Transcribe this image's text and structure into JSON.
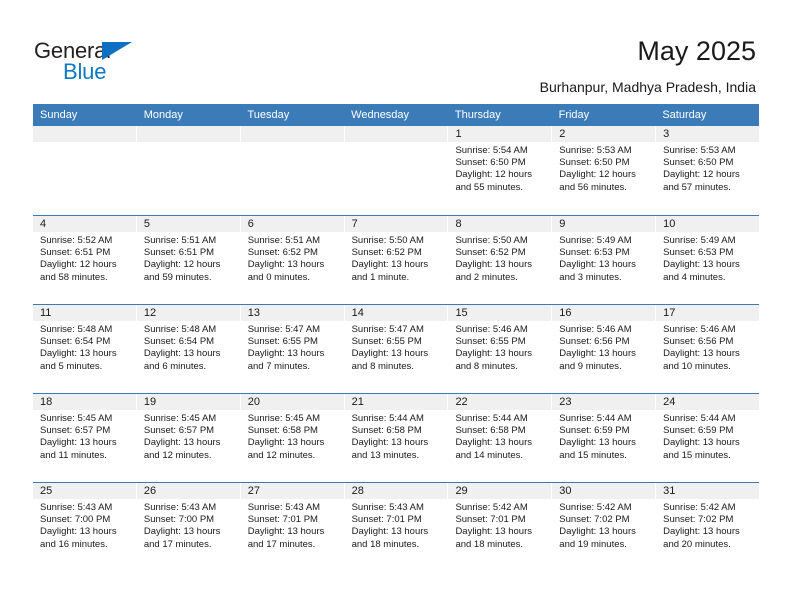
{
  "brand": {
    "name_part1": "General",
    "name_part2": "Blue"
  },
  "header": {
    "title": "May 2025",
    "subtitle": "Burhanpur, Madhya Pradesh, India"
  },
  "colors": {
    "header_blue": "#3b7cb8",
    "brand_blue": "#1079c4",
    "daynum_band": "#f0f0f0"
  },
  "calendar": {
    "day_names": [
      "Sunday",
      "Monday",
      "Tuesday",
      "Wednesday",
      "Thursday",
      "Friday",
      "Saturday"
    ],
    "weeks": [
      [
        {
          "day": "",
          "empty": true
        },
        {
          "day": "",
          "empty": true
        },
        {
          "day": "",
          "empty": true
        },
        {
          "day": "",
          "empty": true
        },
        {
          "day": "1",
          "sunrise": "Sunrise: 5:54 AM",
          "sunset": "Sunset: 6:50 PM",
          "daylight": "Daylight: 12 hours and 55 minutes."
        },
        {
          "day": "2",
          "sunrise": "Sunrise: 5:53 AM",
          "sunset": "Sunset: 6:50 PM",
          "daylight": "Daylight: 12 hours and 56 minutes."
        },
        {
          "day": "3",
          "sunrise": "Sunrise: 5:53 AM",
          "sunset": "Sunset: 6:50 PM",
          "daylight": "Daylight: 12 hours and 57 minutes."
        }
      ],
      [
        {
          "day": "4",
          "sunrise": "Sunrise: 5:52 AM",
          "sunset": "Sunset: 6:51 PM",
          "daylight": "Daylight: 12 hours and 58 minutes."
        },
        {
          "day": "5",
          "sunrise": "Sunrise: 5:51 AM",
          "sunset": "Sunset: 6:51 PM",
          "daylight": "Daylight: 12 hours and 59 minutes."
        },
        {
          "day": "6",
          "sunrise": "Sunrise: 5:51 AM",
          "sunset": "Sunset: 6:52 PM",
          "daylight": "Daylight: 13 hours and 0 minutes."
        },
        {
          "day": "7",
          "sunrise": "Sunrise: 5:50 AM",
          "sunset": "Sunset: 6:52 PM",
          "daylight": "Daylight: 13 hours and 1 minute."
        },
        {
          "day": "8",
          "sunrise": "Sunrise: 5:50 AM",
          "sunset": "Sunset: 6:52 PM",
          "daylight": "Daylight: 13 hours and 2 minutes."
        },
        {
          "day": "9",
          "sunrise": "Sunrise: 5:49 AM",
          "sunset": "Sunset: 6:53 PM",
          "daylight": "Daylight: 13 hours and 3 minutes."
        },
        {
          "day": "10",
          "sunrise": "Sunrise: 5:49 AM",
          "sunset": "Sunset: 6:53 PM",
          "daylight": "Daylight: 13 hours and 4 minutes."
        }
      ],
      [
        {
          "day": "11",
          "sunrise": "Sunrise: 5:48 AM",
          "sunset": "Sunset: 6:54 PM",
          "daylight": "Daylight: 13 hours and 5 minutes."
        },
        {
          "day": "12",
          "sunrise": "Sunrise: 5:48 AM",
          "sunset": "Sunset: 6:54 PM",
          "daylight": "Daylight: 13 hours and 6 minutes."
        },
        {
          "day": "13",
          "sunrise": "Sunrise: 5:47 AM",
          "sunset": "Sunset: 6:55 PM",
          "daylight": "Daylight: 13 hours and 7 minutes."
        },
        {
          "day": "14",
          "sunrise": "Sunrise: 5:47 AM",
          "sunset": "Sunset: 6:55 PM",
          "daylight": "Daylight: 13 hours and 8 minutes."
        },
        {
          "day": "15",
          "sunrise": "Sunrise: 5:46 AM",
          "sunset": "Sunset: 6:55 PM",
          "daylight": "Daylight: 13 hours and 8 minutes."
        },
        {
          "day": "16",
          "sunrise": "Sunrise: 5:46 AM",
          "sunset": "Sunset: 6:56 PM",
          "daylight": "Daylight: 13 hours and 9 minutes."
        },
        {
          "day": "17",
          "sunrise": "Sunrise: 5:46 AM",
          "sunset": "Sunset: 6:56 PM",
          "daylight": "Daylight: 13 hours and 10 minutes."
        }
      ],
      [
        {
          "day": "18",
          "sunrise": "Sunrise: 5:45 AM",
          "sunset": "Sunset: 6:57 PM",
          "daylight": "Daylight: 13 hours and 11 minutes."
        },
        {
          "day": "19",
          "sunrise": "Sunrise: 5:45 AM",
          "sunset": "Sunset: 6:57 PM",
          "daylight": "Daylight: 13 hours and 12 minutes."
        },
        {
          "day": "20",
          "sunrise": "Sunrise: 5:45 AM",
          "sunset": "Sunset: 6:58 PM",
          "daylight": "Daylight: 13 hours and 12 minutes."
        },
        {
          "day": "21",
          "sunrise": "Sunrise: 5:44 AM",
          "sunset": "Sunset: 6:58 PM",
          "daylight": "Daylight: 13 hours and 13 minutes."
        },
        {
          "day": "22",
          "sunrise": "Sunrise: 5:44 AM",
          "sunset": "Sunset: 6:58 PM",
          "daylight": "Daylight: 13 hours and 14 minutes."
        },
        {
          "day": "23",
          "sunrise": "Sunrise: 5:44 AM",
          "sunset": "Sunset: 6:59 PM",
          "daylight": "Daylight: 13 hours and 15 minutes."
        },
        {
          "day": "24",
          "sunrise": "Sunrise: 5:44 AM",
          "sunset": "Sunset: 6:59 PM",
          "daylight": "Daylight: 13 hours and 15 minutes."
        }
      ],
      [
        {
          "day": "25",
          "sunrise": "Sunrise: 5:43 AM",
          "sunset": "Sunset: 7:00 PM",
          "daylight": "Daylight: 13 hours and 16 minutes."
        },
        {
          "day": "26",
          "sunrise": "Sunrise: 5:43 AM",
          "sunset": "Sunset: 7:00 PM",
          "daylight": "Daylight: 13 hours and 17 minutes."
        },
        {
          "day": "27",
          "sunrise": "Sunrise: 5:43 AM",
          "sunset": "Sunset: 7:01 PM",
          "daylight": "Daylight: 13 hours and 17 minutes."
        },
        {
          "day": "28",
          "sunrise": "Sunrise: 5:43 AM",
          "sunset": "Sunset: 7:01 PM",
          "daylight": "Daylight: 13 hours and 18 minutes."
        },
        {
          "day": "29",
          "sunrise": "Sunrise: 5:42 AM",
          "sunset": "Sunset: 7:01 PM",
          "daylight": "Daylight: 13 hours and 18 minutes."
        },
        {
          "day": "30",
          "sunrise": "Sunrise: 5:42 AM",
          "sunset": "Sunset: 7:02 PM",
          "daylight": "Daylight: 13 hours and 19 minutes."
        },
        {
          "day": "31",
          "sunrise": "Sunrise: 5:42 AM",
          "sunset": "Sunset: 7:02 PM",
          "daylight": "Daylight: 13 hours and 20 minutes."
        }
      ]
    ]
  }
}
